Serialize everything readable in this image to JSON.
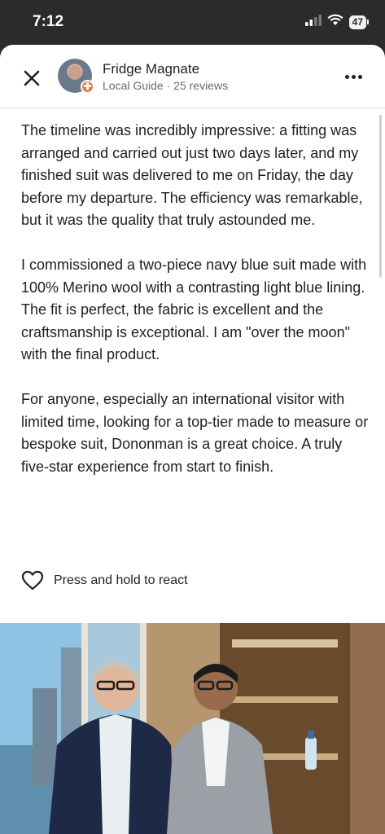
{
  "status_bar": {
    "time": "7:12",
    "battery": "47",
    "icons": [
      "cellular-signal-icon",
      "wifi-icon",
      "battery-icon"
    ]
  },
  "header": {
    "author_name": "Fridge Magnate",
    "author_meta": "Local Guide · 25 reviews",
    "badge_symbol": "✚",
    "icons": [
      "close-icon",
      "more-options-icon"
    ]
  },
  "review": {
    "paragraphs": [
      "The timeline was incredibly impressive: a fitting was arranged and carried out just two days later, and my finished suit was delivered to me on Friday, the day before my departure. The efficiency was remarkable, but it was the quality that truly astounded me.",
      "I commissioned a two-piece navy blue suit made with 100% Merino wool with a contrasting light blue lining. The fit is perfect, the fabric is excellent and the craftsmanship is exceptional. I am \"over the moon\" with the final product.",
      "For anyone, especially an international visitor with limited time, looking for a top-tier made to measure or bespoke suit, Dononman is a great choice. A truly five-star experience from start to finish."
    ]
  },
  "react": {
    "label": "Press and hold to react",
    "icon": "heart-icon"
  },
  "colors": {
    "background_dark": "#2b2b2b",
    "text_primary": "#1f1f1f",
    "text_secondary": "#6b6b6b",
    "badge_orange": "#e8763a"
  }
}
